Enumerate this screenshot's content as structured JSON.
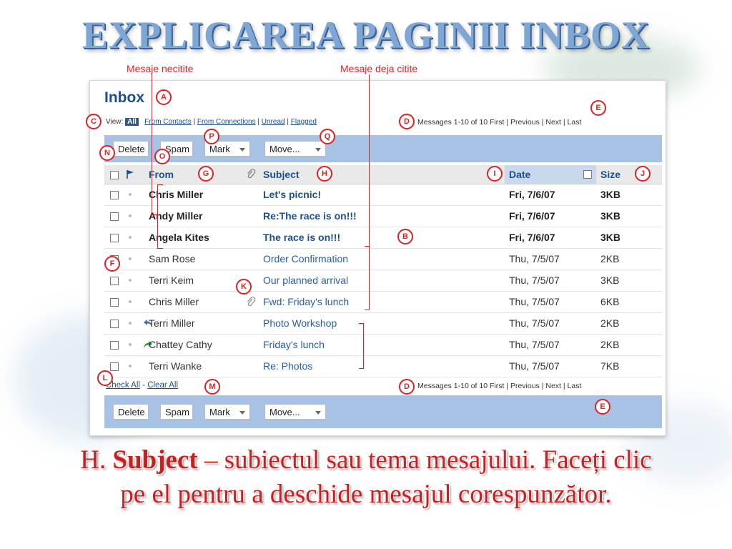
{
  "slide": {
    "heading": "EXPLICAREA PAGINII INBOX",
    "callout_unread": "Mesaje necitite",
    "callout_read": "Mesaje deja citite",
    "caption_prefix": "H. ",
    "caption_bold": "Subject",
    "caption_rest": " – subiectul sau tema mesajului. Faceți clic",
    "caption_line2": "pe el pentru a deschide mesajul corespunzător."
  },
  "inbox": {
    "title": "Inbox",
    "view_label": "View:",
    "view_all": "All",
    "view_filters": [
      "From Contacts",
      "From Connections",
      "Unread",
      "Flagged"
    ],
    "pager_text": "Messages 1-10 of 10  First | Previous | Next | Last",
    "toolbar": {
      "delete": "Delete",
      "spam": "Spam",
      "mark": "Mark",
      "move": "Move..."
    },
    "columns": {
      "from": "From",
      "subject": "Subject",
      "date": "Date",
      "size": "Size"
    },
    "check_all": "Check All",
    "clear_all": "Clear All",
    "separator": "-",
    "messages": [
      {
        "from": "Chris Miller",
        "subject": "Let's picnic!",
        "date": "Fri, 7/6/07",
        "size": "3KB",
        "unread": true,
        "attachment": false,
        "status": ""
      },
      {
        "from": "Andy Miller",
        "subject": "Re:The race is on!!!",
        "date": "Fri, 7/6/07",
        "size": "3KB",
        "unread": true,
        "attachment": false,
        "status": ""
      },
      {
        "from": "Angela Kites",
        "subject": "The race is on!!!",
        "date": "Fri, 7/6/07",
        "size": "3KB",
        "unread": true,
        "attachment": false,
        "status": ""
      },
      {
        "from": "Sam Rose",
        "subject": "Order Confirmation",
        "date": "Thu, 7/5/07",
        "size": "2KB",
        "unread": false,
        "attachment": false,
        "status": ""
      },
      {
        "from": "Terri Keim",
        "subject": "Our planned arrival",
        "date": "Thu, 7/5/07",
        "size": "3KB",
        "unread": false,
        "attachment": false,
        "status": ""
      },
      {
        "from": "Chris Miller",
        "subject": "Fwd: Friday's lunch",
        "date": "Thu, 7/5/07",
        "size": "6KB",
        "unread": false,
        "attachment": true,
        "status": ""
      },
      {
        "from": "Terri Miller",
        "subject": "Photo Workshop",
        "date": "Thu, 7/5/07",
        "size": "2KB",
        "unread": false,
        "attachment": false,
        "status": "replied"
      },
      {
        "from": "Chattey Cathy",
        "subject": "Friday's lunch",
        "date": "Thu, 7/5/07",
        "size": "2KB",
        "unread": false,
        "attachment": false,
        "status": "forwarded"
      },
      {
        "from": "Terri Wanke",
        "subject": "Re: Photos",
        "date": "Thu, 7/5/07",
        "size": "7KB",
        "unread": false,
        "attachment": false,
        "status": ""
      }
    ]
  },
  "markers": [
    "A",
    "B",
    "C",
    "D",
    "E",
    "F",
    "G",
    "H",
    "I",
    "J",
    "K",
    "L",
    "M",
    "N",
    "O",
    "P",
    "Q"
  ],
  "colors": {
    "accent": "#1d4f8c",
    "toolbar": "#a8c2e6",
    "annotation": "#e02020"
  }
}
